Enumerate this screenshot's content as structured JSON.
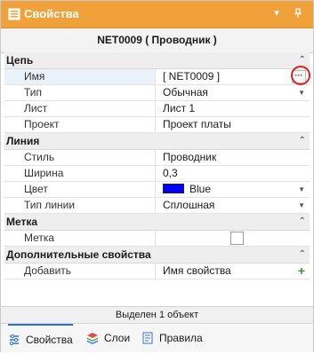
{
  "window": {
    "title": "Свойства",
    "object_title": "NET0009 ( Проводник )"
  },
  "categories": {
    "chain": {
      "label": "Цепь"
    },
    "line": {
      "label": "Линия"
    },
    "mark": {
      "label": "Метка"
    },
    "extra": {
      "label": "Дополнительные свойства"
    }
  },
  "chain_rows": [
    {
      "name": "Имя",
      "value": "[ NET0009 ]"
    },
    {
      "name": "Тип",
      "value": "Обычная"
    },
    {
      "name": "Лист",
      "value": "Лист 1"
    },
    {
      "name": "Проект",
      "value": "Проект платы"
    }
  ],
  "line_rows": [
    {
      "name": "Стиль",
      "value": "Проводник"
    },
    {
      "name": "Ширина",
      "value": "0,3"
    },
    {
      "name": "Цвет",
      "value": "Blue",
      "color": "#0000ff"
    },
    {
      "name": "Тип линии",
      "value": "Сплошная"
    }
  ],
  "mark_rows": [
    {
      "name": "Метка",
      "checked": false
    }
  ],
  "extra_rows": [
    {
      "name": "Добавить",
      "value": "Имя свойства"
    }
  ],
  "status": "Выделен 1 объект",
  "tabs": [
    {
      "label": "Свойства",
      "icon": "properties-icon",
      "active": true
    },
    {
      "label": "Слои",
      "icon": "layers-icon",
      "active": false
    },
    {
      "label": "Правила",
      "icon": "rules-icon",
      "active": false
    }
  ],
  "colors": {
    "titlebar": "#f0a13a",
    "accent": "#2f6fd6",
    "highlight": "#e02020"
  }
}
